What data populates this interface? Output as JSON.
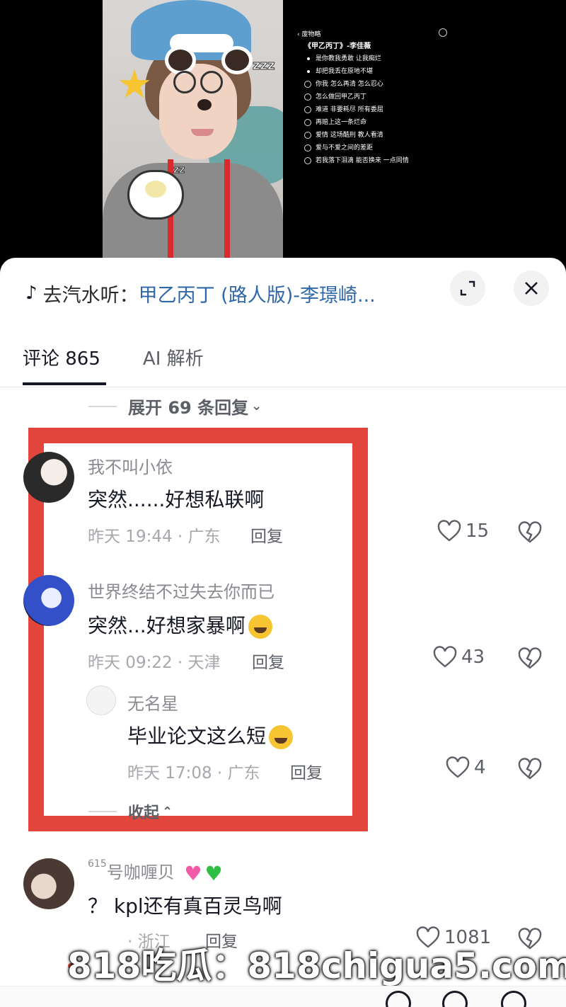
{
  "video": {
    "lyrics": {
      "back_label": "废物略",
      "song_title": "《甲乙丙丁》-李佳薇",
      "lines": [
        "是你教我勇敢 让我痴烂",
        "却把我丢在原地不堪",
        "你我 怎么再清 怎么忍心",
        "怎么做回甲乙丙丁",
        "难道 非要耗尽 所有委屈",
        "再赔上这一条烂命",
        "爱情 这场酷刑 教人看清",
        "爱与不爱之间的差距",
        "若我落下泪滴 能否换来 一点同情"
      ]
    }
  },
  "music_bar": {
    "prefix": "去汽水听：",
    "song": "甲乙丙丁 (路人版)-李璟崎..."
  },
  "tabs": [
    {
      "label": "评论 865",
      "active": true
    },
    {
      "label": "AI 解析",
      "active": false
    }
  ],
  "expand_replies": "展开 69 条回复",
  "comments": [
    {
      "user": "我不叫小依",
      "text": "突然......好想私联啊",
      "meta": "昨天 19:44 · 广东",
      "reply_label": "回复",
      "likes": "15"
    },
    {
      "user": "世界终结不过失去你而已",
      "text": "突然...好想家暴啊",
      "meta": "昨天 09:22 · 天津",
      "reply_label": "回复",
      "likes": "43",
      "replies": [
        {
          "user": "无名星",
          "text": "毕业论文这么短",
          "meta": "昨天 17:08 · 广东",
          "reply_label": "回复",
          "likes": "4"
        }
      ],
      "collapse_label": "收起"
    },
    {
      "user_prefix": "615",
      "user": "号咖喱贝",
      "text": "？ kpl还有真百灵鸟啊",
      "meta": "· 浙江",
      "reply_label": "回复",
      "likes": "1081"
    }
  ],
  "watermark": "818吃瓜：818chigua5.com",
  "colors": {
    "accent_link": "#2f67a8",
    "highlight_box": "#e2453c",
    "text_primary": "#161823",
    "text_secondary": "#8a8b91"
  }
}
